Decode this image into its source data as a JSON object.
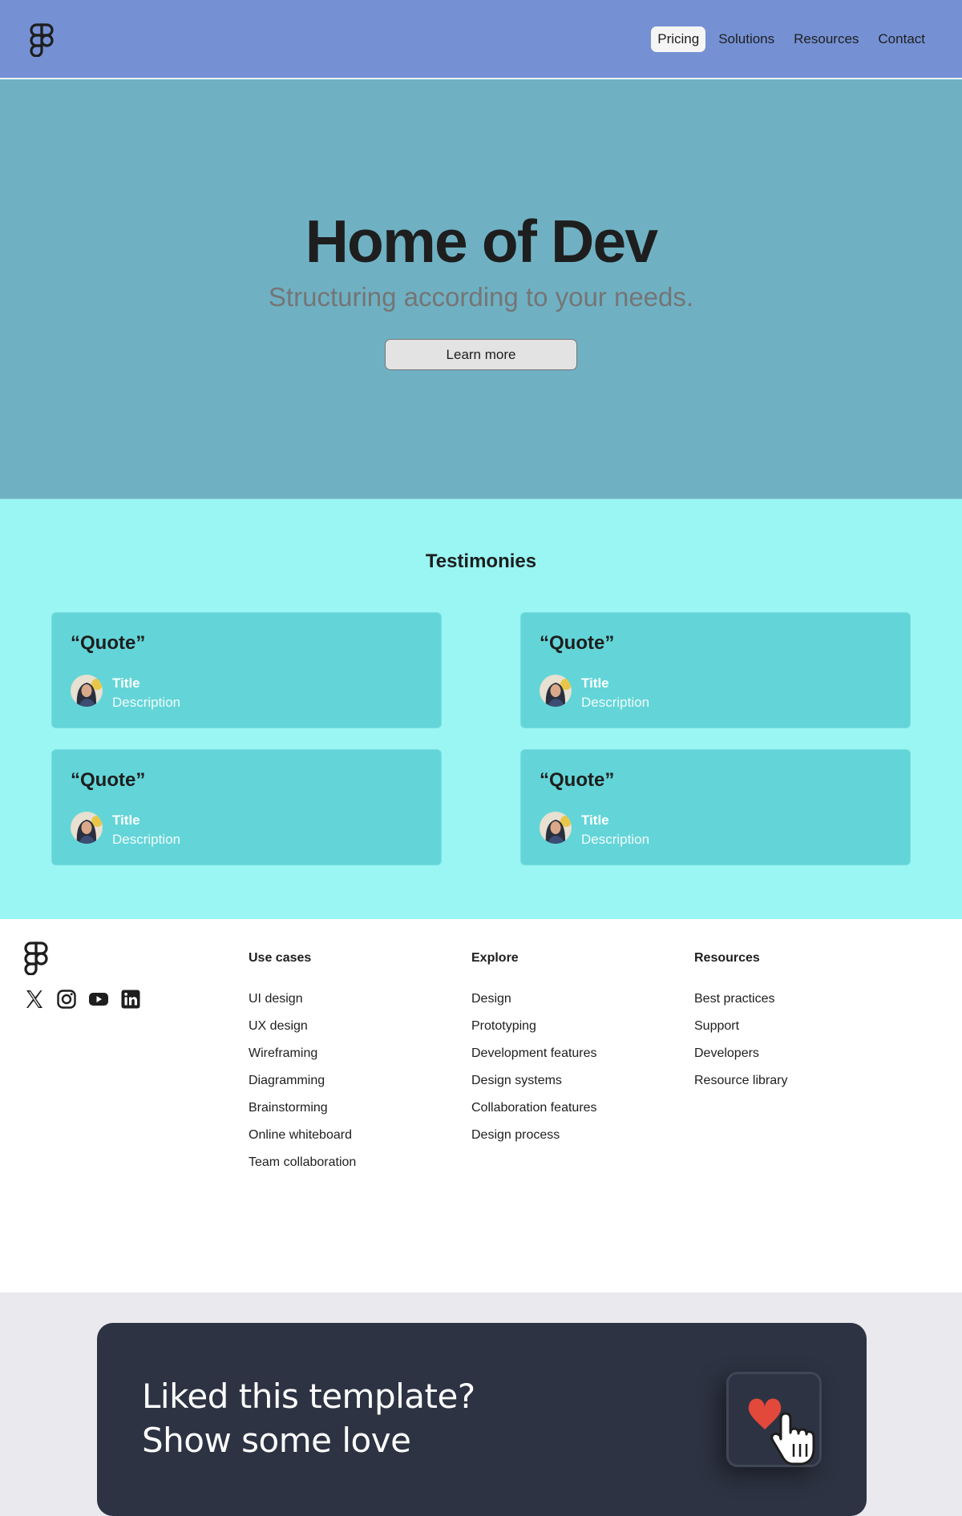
{
  "header": {
    "nav": [
      {
        "label": "Pricing",
        "active": true
      },
      {
        "label": "Solutions",
        "active": false
      },
      {
        "label": "Resources",
        "active": false
      },
      {
        "label": "Contact",
        "active": false
      }
    ]
  },
  "hero": {
    "title": "Home of Dev",
    "subtitle": "Structuring according to your needs.",
    "button_label": "Learn more"
  },
  "testimonies": {
    "title": "Testimonies",
    "cards": [
      {
        "quote": "“Quote”",
        "title": "Title",
        "description": "Description"
      },
      {
        "quote": "“Quote”",
        "title": "Title",
        "description": "Description"
      },
      {
        "quote": "“Quote”",
        "title": "Title",
        "description": "Description"
      },
      {
        "quote": "“Quote”",
        "title": "Title",
        "description": "Description"
      }
    ]
  },
  "footer": {
    "socials": [
      "x-icon",
      "instagram-icon",
      "youtube-icon",
      "linkedin-icon"
    ],
    "columns": [
      {
        "heading": "Use cases",
        "links": [
          "UI design",
          "UX design",
          "Wireframing",
          "Diagramming",
          "Brainstorming",
          "Online whiteboard",
          "Team collaboration"
        ]
      },
      {
        "heading": "Explore",
        "links": [
          "Design",
          "Prototyping",
          "Development features",
          "Design systems",
          "Collaboration features",
          "Design process"
        ]
      },
      {
        "heading": "Resources",
        "links": [
          "Best practices",
          "Support",
          "Developers",
          "Resource library"
        ]
      }
    ]
  },
  "promo": {
    "line1": "Liked this template?",
    "line2": "Show some love"
  },
  "colors": {
    "header_bg": "#7591d4",
    "hero_bg": "#6fb1c3",
    "testimonies_bg": "#99f6f3",
    "card_bg": "#63d5d8",
    "promo_bg": "#2d3342",
    "heart": "#e2493b"
  }
}
